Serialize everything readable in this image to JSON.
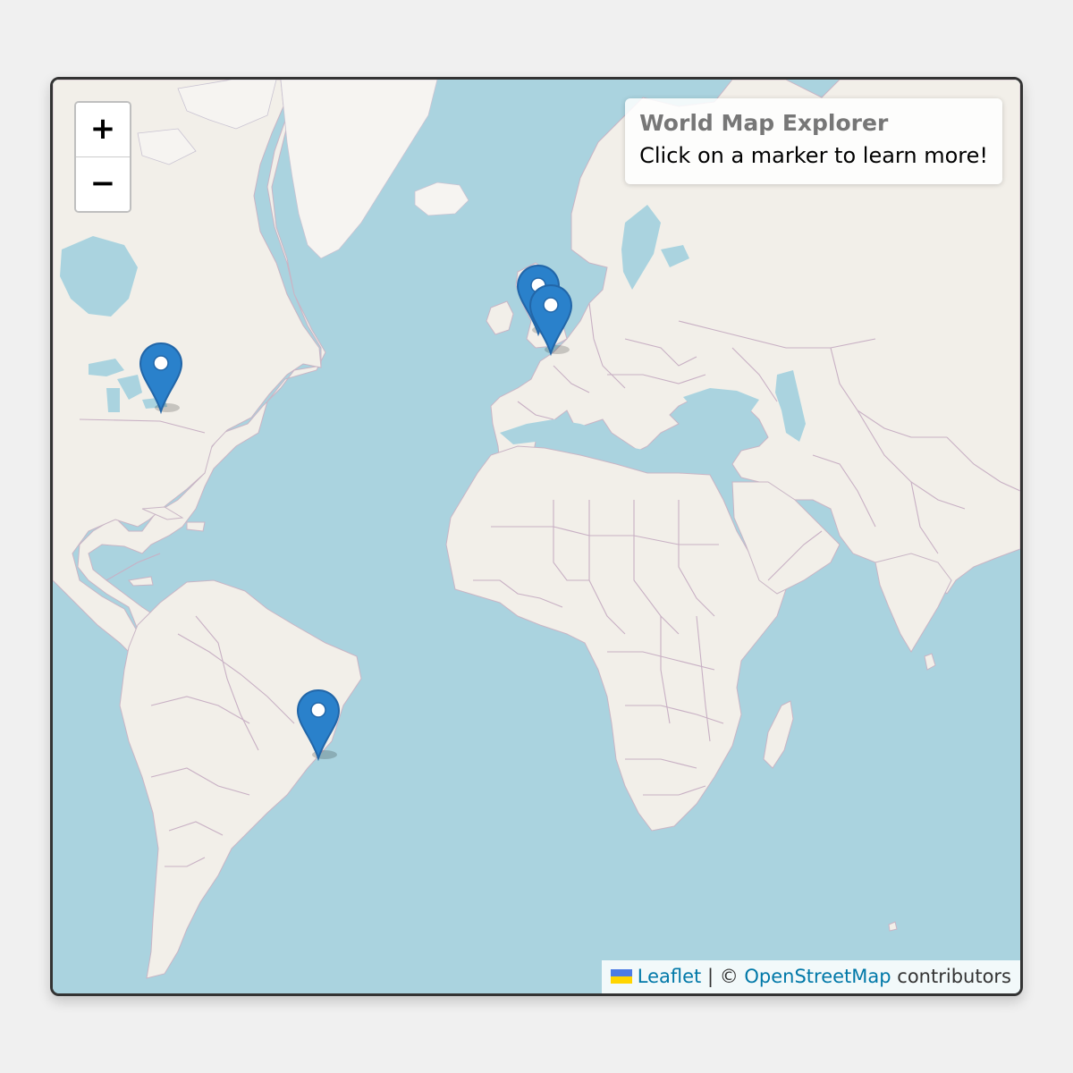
{
  "info": {
    "title": "World Map Explorer",
    "text": "Click on a marker to learn more!"
  },
  "zoom": {
    "in_label": "+",
    "out_label": "−"
  },
  "attribution": {
    "leaflet_label": "Leaflet",
    "separator": " | © ",
    "osm_label": "OpenStreetMap",
    "suffix": " contributors"
  },
  "colors": {
    "water": "#aad3df",
    "land": "#f2efe9",
    "borders": "#c8b0c4",
    "marker": "#2a81cb",
    "link": "#0078a8"
  },
  "markers": [
    {
      "name": "marker-new-york",
      "icon": "map-pin-icon"
    },
    {
      "name": "marker-london",
      "icon": "map-pin-icon"
    },
    {
      "name": "marker-paris",
      "icon": "map-pin-icon"
    },
    {
      "name": "marker-rio-de-janeiro",
      "icon": "map-pin-icon"
    }
  ]
}
